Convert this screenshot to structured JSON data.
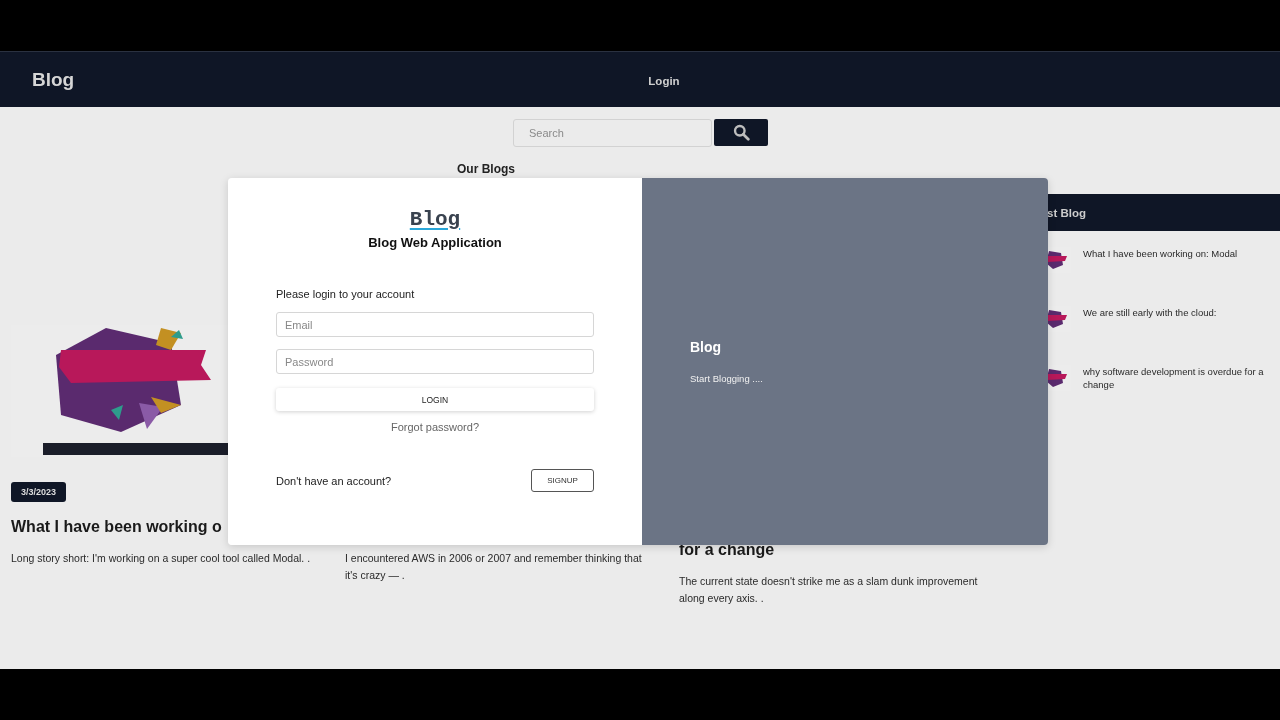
{
  "navbar": {
    "brand": "Blog",
    "links": [
      {
        "label": "Login"
      }
    ]
  },
  "search": {
    "placeholder": "Search"
  },
  "main": {
    "heading": "Our Blogs",
    "cards": [
      {
        "date": "3/3/2023",
        "title": "What I have been working o",
        "excerpt": "Long story short: I'm working on a super cool tool called Modal. ."
      },
      {
        "excerpt": "I encountered AWS in 2006 or 2007 and remember thinking that it's crazy — ."
      },
      {
        "title": "for a change",
        "excerpt": "The current state doesn't strike me as a slam dunk improvement along every axis. ."
      }
    ]
  },
  "sidebar": {
    "heading": "st Blog",
    "items": [
      {
        "title": "What I have been working on: Modal"
      },
      {
        "title": "We are still early with the cloud:"
      },
      {
        "title": "why software development is overdue for a change"
      }
    ]
  },
  "modal": {
    "logo": "Blog",
    "subtitle": "Blog Web Application",
    "prompt": "Please login to your account",
    "fields": [
      {
        "placeholder": "Email"
      },
      {
        "placeholder": "Password"
      }
    ],
    "login_button": "LOGIN",
    "forgot_link": "Forgot password?",
    "signup_prompt": "Don't have an account?",
    "signup_button": "SIGNUP",
    "side_title": "Blog",
    "side_text": "Start Blogging ...."
  }
}
